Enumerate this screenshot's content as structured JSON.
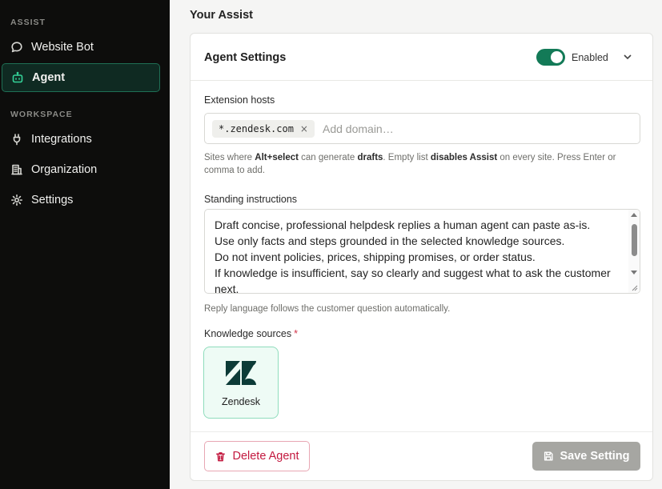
{
  "sidebar": {
    "sections": [
      {
        "label": "ASSIST"
      },
      {
        "label": "WORKSPACE"
      }
    ],
    "items": [
      {
        "label": "Website Bot",
        "icon": "chat-bubble-icon",
        "active": false
      },
      {
        "label": "Agent",
        "icon": "bot-icon",
        "active": true
      },
      {
        "label": "Integrations",
        "icon": "plug-icon",
        "active": false
      },
      {
        "label": "Organization",
        "icon": "building-icon",
        "active": false
      },
      {
        "label": "Settings",
        "icon": "gear-icon",
        "active": false
      }
    ]
  },
  "main": {
    "heading": "Your Assist",
    "card": {
      "title": "Agent Settings",
      "toggle_label": "Enabled",
      "toggle_on": true,
      "extension_hosts": {
        "label": "Extension hosts",
        "chips": [
          "*.zendesk.com"
        ],
        "chip_remove": "×",
        "placeholder": "Add domain…",
        "help": {
          "p1": "Sites where ",
          "b1": "Alt+select",
          "p2": " can generate ",
          "b2": "drafts",
          "p3": ". Empty list ",
          "b3": "disables Assist",
          "p4": " on every site. Press Enter or comma to add."
        }
      },
      "standing_instructions": {
        "label": "Standing instructions",
        "value": "Draft concise, professional helpdesk replies a human agent can paste as-is.\nUse only facts and steps grounded in the selected knowledge sources.\nDo not invent policies, prices, shipping promises, or order status.\nIf knowledge is insufficient, say so clearly and suggest what to ask the customer next.",
        "help": "Reply language follows the customer question automatically."
      },
      "knowledge_sources": {
        "label": "Knowledge sources",
        "required_mark": "*",
        "items": [
          {
            "name": "Zendesk",
            "icon": "zendesk-logo-icon",
            "selected": true
          }
        ]
      },
      "delete_label": "Delete Agent",
      "save_label": "Save Setting"
    }
  },
  "colors": {
    "sidebar_bg": "#0d0d0c",
    "accent": "#137a57",
    "active_border": "#1f6f55",
    "danger": "#c3193f",
    "save_disabled": "#a6a6a2"
  }
}
